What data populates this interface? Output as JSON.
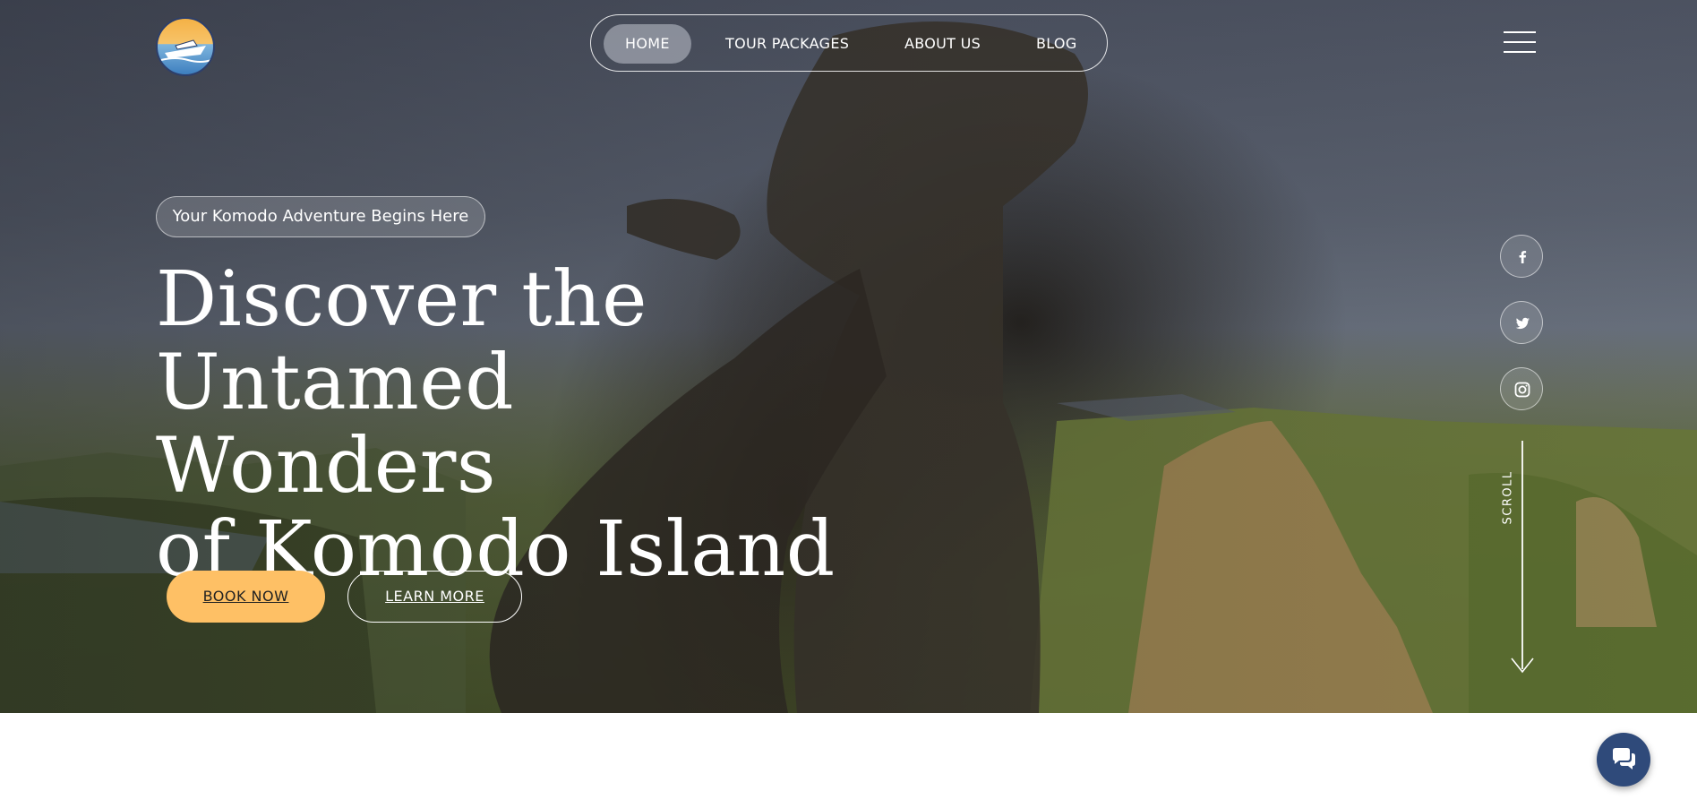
{
  "nav": {
    "items": [
      {
        "label": "HOME",
        "active": true
      },
      {
        "label": "TOUR PACKAGES",
        "active": false
      },
      {
        "label": "ABOUT US",
        "active": false
      },
      {
        "label": "BLOG",
        "active": false
      }
    ]
  },
  "hero": {
    "tagline": "Your Komodo Adventure Begins Here",
    "headline_lines": [
      "Discover the",
      "Untamed Wonders",
      "of Komodo Island"
    ],
    "book_label": "BOOK NOW",
    "learn_label": "LEARN MORE",
    "scroll_label": "SCROLL"
  },
  "social": [
    {
      "icon": "facebook-icon"
    },
    {
      "icon": "twitter-icon"
    },
    {
      "icon": "instagram-icon"
    }
  ],
  "colors": {
    "accent": "#fec065",
    "chat_button": "#2f4a7a",
    "logo_border": "#2d3f6b"
  }
}
